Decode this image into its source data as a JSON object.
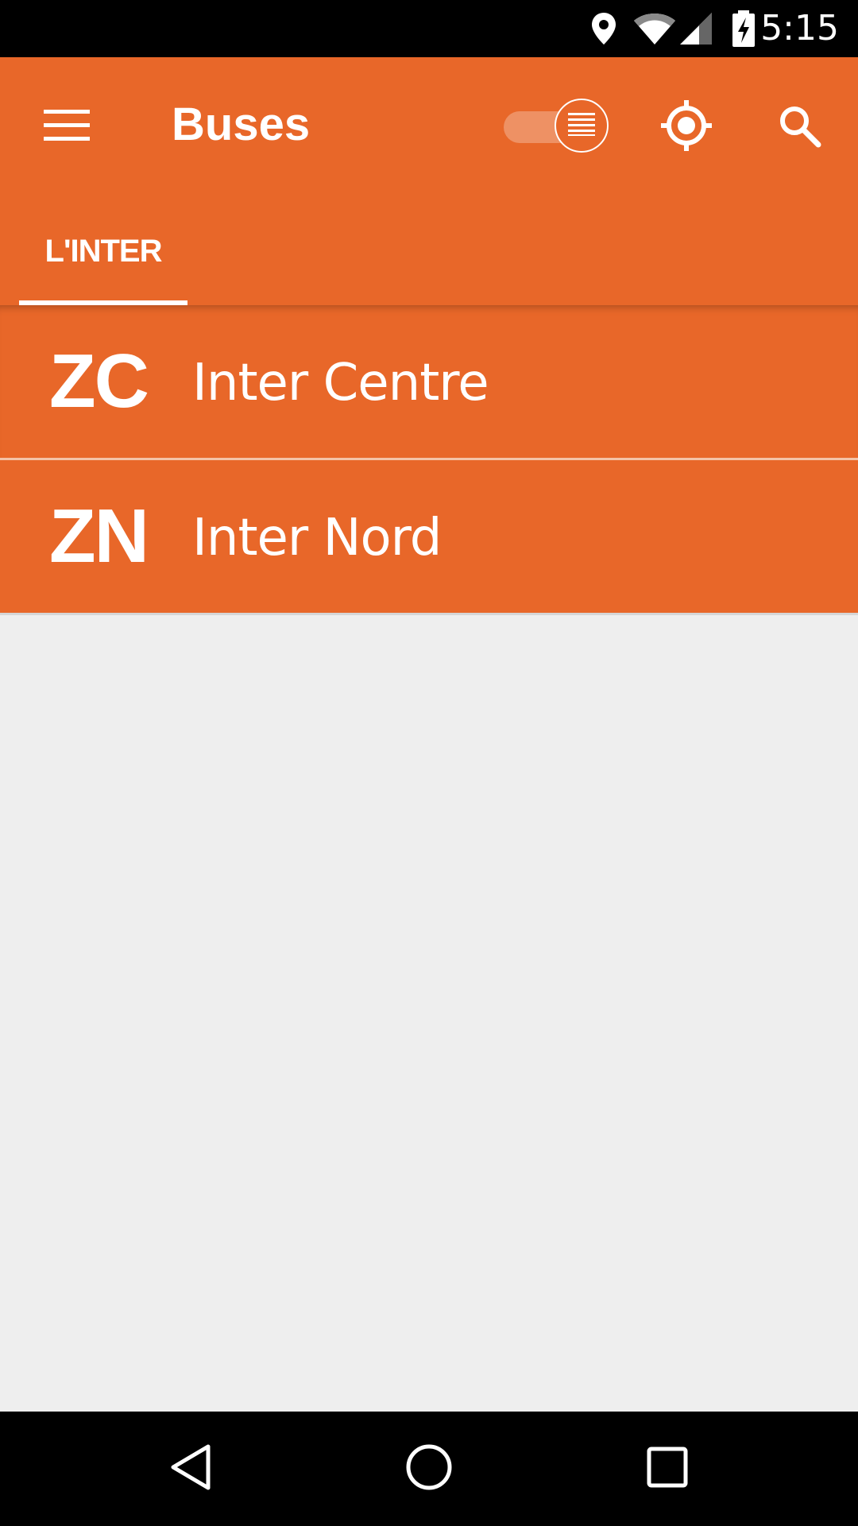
{
  "status_bar": {
    "time": "5:15",
    "icons": [
      "location-pin-icon",
      "wifi-icon",
      "cell-signal-icon",
      "battery-charging-icon"
    ]
  },
  "app_bar": {
    "title": "Buses",
    "menu_icon": "hamburger-menu-icon",
    "toggle_icon": "list-icon",
    "locate_icon": "my-location-icon",
    "search_icon": "search-icon",
    "background_color": "#e86729"
  },
  "tabs": [
    {
      "label": "L'INTER",
      "selected": true
    }
  ],
  "routes": [
    {
      "code": "ZC",
      "name": "Inter Centre"
    },
    {
      "code": "ZN",
      "name": "Inter Nord"
    }
  ],
  "nav_bar": {
    "icons": [
      "back-icon",
      "home-icon",
      "recents-icon"
    ]
  }
}
